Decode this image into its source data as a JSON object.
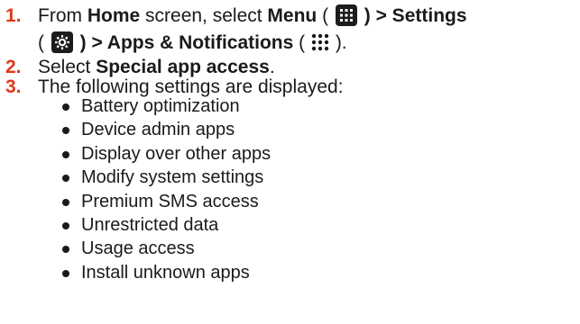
{
  "steps": [
    {
      "number": "1.",
      "line1_prefix": "From ",
      "home": "Home",
      "mid1": " screen, select ",
      "menu": "Menu",
      "open_paren": " ( ",
      "close_arrow_settings": " ) > Settings",
      "line2_open": "( ",
      "close_arrow_apps": " ) > Apps & Notifications",
      "line2_open2": " ( ",
      "line2_close": " )."
    },
    {
      "number": "2.",
      "prefix": "Select ",
      "bold": "Special app access",
      "suffix": "."
    },
    {
      "number": "3.",
      "text": "The following settings are displayed:"
    }
  ],
  "settings_list": [
    "Battery optimization",
    "Device admin apps",
    "Display over other apps",
    "Modify system settings",
    "Premium SMS access",
    "Unrestricted data",
    "Usage access",
    "Install unknown apps"
  ],
  "icons": [
    "grid-menu-icon",
    "gear-icon",
    "apps-dots-icon"
  ],
  "colors": {
    "step_number": "#e03a1a",
    "text": "#1a1a1a",
    "icon_bg": "#1c1c1c"
  }
}
